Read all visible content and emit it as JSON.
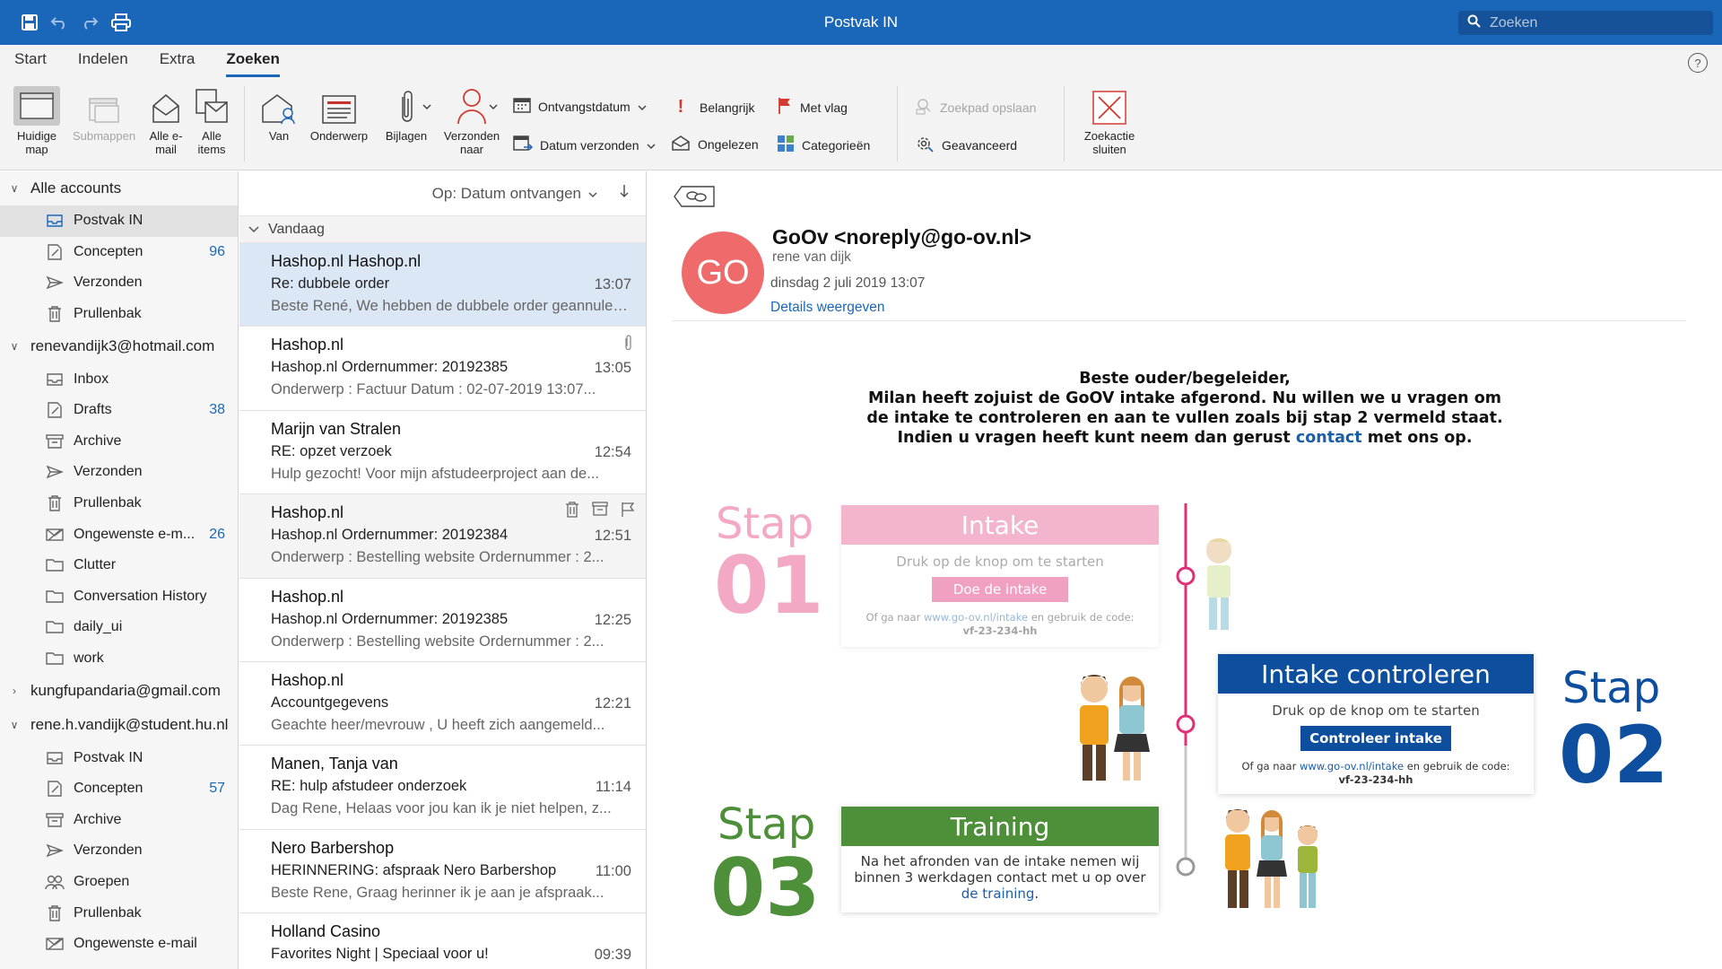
{
  "window": {
    "title": "Postvak IN",
    "search_placeholder": "Zoeken"
  },
  "ribbon_tabs": [
    "Start",
    "Indelen",
    "Extra",
    "Zoeken"
  ],
  "ribbon": {
    "current_folder": "Huidige map",
    "subfolders": "Submappen",
    "all_mail": "Alle e-mail",
    "all_items": "Alle items",
    "from": "Van",
    "subject": "Onderwerp",
    "attachments": "Bijlagen",
    "sent_to": "Verzonden naar",
    "received_date": "Ontvangstdatum",
    "sent_date": "Datum verzonden",
    "important": "Belangrijk",
    "unread": "Ongelezen",
    "flagged": "Met vlag",
    "categories": "Categorieën",
    "save_search": "Zoekpad opslaan",
    "advanced": "Geavanceerd",
    "close_search": "Zoekactie sluiten"
  },
  "folders": {
    "accounts": [
      {
        "name": "Alle accounts",
        "expanded": true,
        "items": [
          {
            "label": "Postvak IN",
            "icon": "inbox-icon",
            "count": "",
            "selected": true
          },
          {
            "label": "Concepten",
            "icon": "drafts-icon",
            "count": "96"
          },
          {
            "label": "Verzonden",
            "icon": "sent-icon",
            "count": ""
          },
          {
            "label": "Prullenbak",
            "icon": "trash-icon",
            "count": ""
          }
        ]
      },
      {
        "name": "renevandijk3@hotmail.com",
        "expanded": true,
        "items": [
          {
            "label": "Inbox",
            "icon": "inbox-icon",
            "count": ""
          },
          {
            "label": "Drafts",
            "icon": "drafts-icon",
            "count": "38"
          },
          {
            "label": "Archive",
            "icon": "archive-icon",
            "count": ""
          },
          {
            "label": "Verzonden",
            "icon": "sent-icon",
            "count": ""
          },
          {
            "label": "Prullenbak",
            "icon": "trash-icon",
            "count": ""
          },
          {
            "label": "Ongewenste e-m...",
            "icon": "junk-icon",
            "count": "26"
          },
          {
            "label": "Clutter",
            "icon": "folder-icon",
            "count": ""
          },
          {
            "label": "Conversation History",
            "icon": "folder-icon",
            "count": ""
          },
          {
            "label": "daily_ui",
            "icon": "folder-icon",
            "count": ""
          },
          {
            "label": "work",
            "icon": "folder-icon",
            "count": ""
          }
        ]
      },
      {
        "name": "kungfupandaria@gmail.com",
        "expanded": false,
        "items": []
      },
      {
        "name": "rene.h.vandijk@student.hu.nl",
        "expanded": true,
        "items": [
          {
            "label": "Postvak IN",
            "icon": "inbox-icon",
            "count": ""
          },
          {
            "label": "Concepten",
            "icon": "drafts-icon",
            "count": "57"
          },
          {
            "label": "Archive",
            "icon": "archive-icon",
            "count": ""
          },
          {
            "label": "Verzonden",
            "icon": "sent-icon",
            "count": ""
          },
          {
            "label": "Groepen",
            "icon": "groups-icon",
            "count": ""
          },
          {
            "label": "Prullenbak",
            "icon": "trash-icon",
            "count": ""
          },
          {
            "label": "Ongewenste e-mail",
            "icon": "junk-icon",
            "count": ""
          }
        ]
      }
    ]
  },
  "messages": {
    "sort_label": "Op: Datum ontvangen",
    "group_label": "Vandaag",
    "items": [
      {
        "sender": "Hashop.nl Hashop.nl",
        "subject": "Re: dubbele order",
        "time": "13:07",
        "preview": "Beste René, We hebben de dubbele order geannuleerd...",
        "selected": true
      },
      {
        "sender": "Hashop.nl",
        "subject": "Hashop.nl Ordernummer: 20192385",
        "time": "13:05",
        "preview": "Onderwerp : Factuur Datum : 02-07-2019 13:07...",
        "attachment": true
      },
      {
        "sender": "Marijn van Stralen",
        "subject": "RE: opzet verzoek",
        "time": "12:54",
        "preview": "Hulp gezocht! Voor mijn afstudeerproject aan de..."
      },
      {
        "sender": "Hashop.nl",
        "subject": "Hashop.nl Ordernummer: 20192384",
        "time": "12:51",
        "preview": "Onderwerp : Bestelling website Ordernummer : 2...",
        "hover": true
      },
      {
        "sender": "Hashop.nl",
        "subject": "Hashop.nl Ordernummer: 20192385",
        "time": "12:25",
        "preview": "Onderwerp : Bestelling website Ordernummer : 2..."
      },
      {
        "sender": "Hashop.nl",
        "subject": "Accountgegevens",
        "time": "12:21",
        "preview": "Geachte heer/mevrouw , U heeft zich aangemeld..."
      },
      {
        "sender": "Manen, Tanja van",
        "subject": "RE: hulp afstudeer onderzoek",
        "time": "11:14",
        "preview": "Dag Rene, Helaas voor jou kan ik je niet helpen, z..."
      },
      {
        "sender": "Nero Barbershop",
        "subject": "HERINNERING: afspraak Nero Barbershop",
        "time": "11:00",
        "preview": "Beste Rene, Graag herinner ik je aan je afspraak..."
      },
      {
        "sender": "Holland Casino",
        "subject": "Favorites Night | Speciaal voor u!",
        "time": "09:39",
        "preview": ""
      }
    ]
  },
  "reader": {
    "avatar_initials": "GO",
    "from": "GoOv <noreply@go-ov.nl>",
    "to": "rene van dijk",
    "date": "dinsdag 2 juli 2019 13:07",
    "details_link": "Details weergeven",
    "body_line1": "Beste ouder/begeleider,",
    "body_line2": "Milan heeft zojuist de GoOV intake afgerond. Nu willen we u vragen om",
    "body_line3": "de intake te controleren en aan te vullen zoals bij stap 2 vermeld staat.",
    "body_line4a": "Indien u vragen heeft kunt neem dan gerust",
    "body_link": "contact",
    "body_line4b": "met ons op.",
    "steps": {
      "stap_word": "Stap",
      "step1": {
        "num": "01",
        "title": "Intake",
        "text": "Druk op de knop om te starten",
        "button": "Doe de intake",
        "small_a": "Of ga naar",
        "small_link": "www.go-ov.nl/intake",
        "small_b": "en gebruik de code:",
        "code": "vf-23-234-hh",
        "color": "#f5b6cf"
      },
      "step2": {
        "num": "02",
        "title": "Intake controleren",
        "text": "Druk op de knop om te starten",
        "button": "Controleer intake",
        "small_a": "Of ga naar",
        "small_link": "www.go-ov.nl/intake",
        "small_b": "en gebruik de code:",
        "code": "vf-23-234-hh",
        "color": "#0d4f9e"
      },
      "step3": {
        "num": "03",
        "title": "Training",
        "text_a": "Na het afronden van de intake nemen wij",
        "text_b": "binnen 3 werkdagen contact met u op over",
        "link": "de training",
        "text_c": ".",
        "color": "#4e8f3a"
      }
    }
  }
}
